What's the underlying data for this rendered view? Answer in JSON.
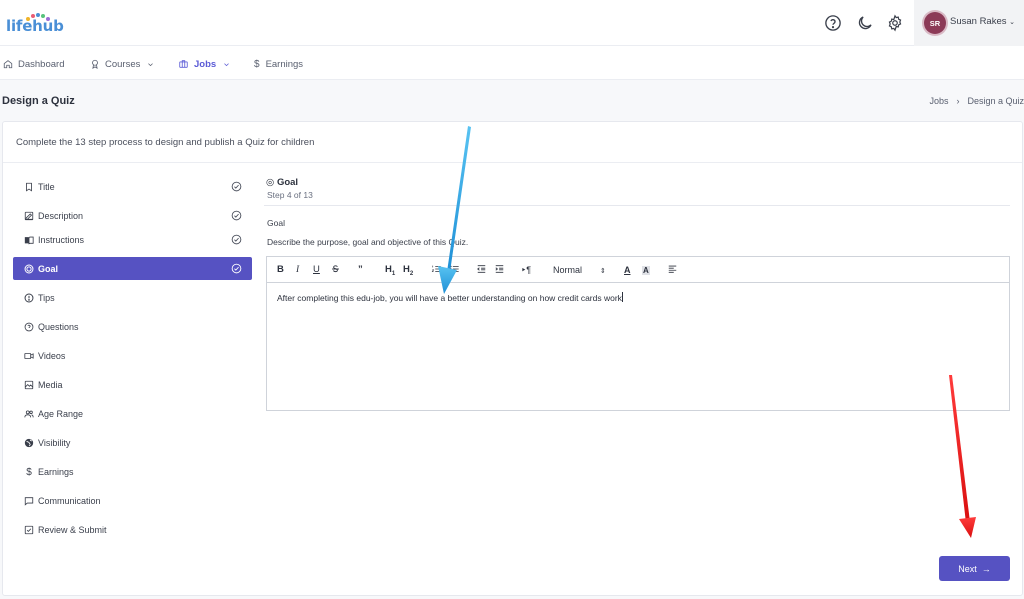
{
  "app": {
    "logo_text": "lifehub"
  },
  "user": {
    "initials": "SR",
    "name": "Susan Rakes"
  },
  "nav": {
    "items": [
      {
        "label": "Dashboard",
        "icon": "home-icon"
      },
      {
        "label": "Courses",
        "icon": "certificate-icon"
      },
      {
        "label": "Jobs",
        "icon": "briefcase-icon"
      },
      {
        "label": "Earnings",
        "icon": "dollar-icon"
      }
    ]
  },
  "header": {
    "title": "Design a Quiz",
    "breadcrumb": [
      "Jobs",
      "Design a Quiz"
    ]
  },
  "card": {
    "intro": "Complete the 13 step process to design and publish a Quiz for children"
  },
  "steps": [
    {
      "label": "Title",
      "icon": "bookmark-icon",
      "done": true
    },
    {
      "label": "Description",
      "icon": "edit-icon",
      "done": true
    },
    {
      "label": "Instructions",
      "icon": "book-icon",
      "done": true
    },
    {
      "label": "Goal",
      "icon": "target-icon",
      "done": true,
      "active": true
    },
    {
      "label": "Tips",
      "icon": "info-circle-icon",
      "done": false
    },
    {
      "label": "Questions",
      "icon": "question-circle-icon",
      "done": false
    },
    {
      "label": "Videos",
      "icon": "video-icon",
      "done": false
    },
    {
      "label": "Media",
      "icon": "image-icon",
      "done": false
    },
    {
      "label": "Age Range",
      "icon": "users-icon",
      "done": false
    },
    {
      "label": "Visibility",
      "icon": "globe-icon",
      "done": false
    },
    {
      "label": "Earnings",
      "icon": "dollar-icon",
      "done": false
    },
    {
      "label": "Communication",
      "icon": "message-icon",
      "done": false
    },
    {
      "label": "Review & Submit",
      "icon": "checkbox-icon",
      "done": false
    }
  ],
  "content": {
    "section_title": "Goal",
    "step_text": "Step 4 of 13",
    "field_label": "Goal",
    "field_desc": "Describe the purpose, goal and objective of this Quiz.",
    "editor": {
      "style_select": "Normal",
      "text": "After completing this edu-job, you will have a better understanding on how credit cards work"
    }
  },
  "actions": {
    "next_label": "Next"
  },
  "colors": {
    "accent": "#5652c2",
    "nav_active": "#5b5bd6",
    "arrow_blue": "#2fa7e6",
    "arrow_red": "#e31b1b"
  }
}
